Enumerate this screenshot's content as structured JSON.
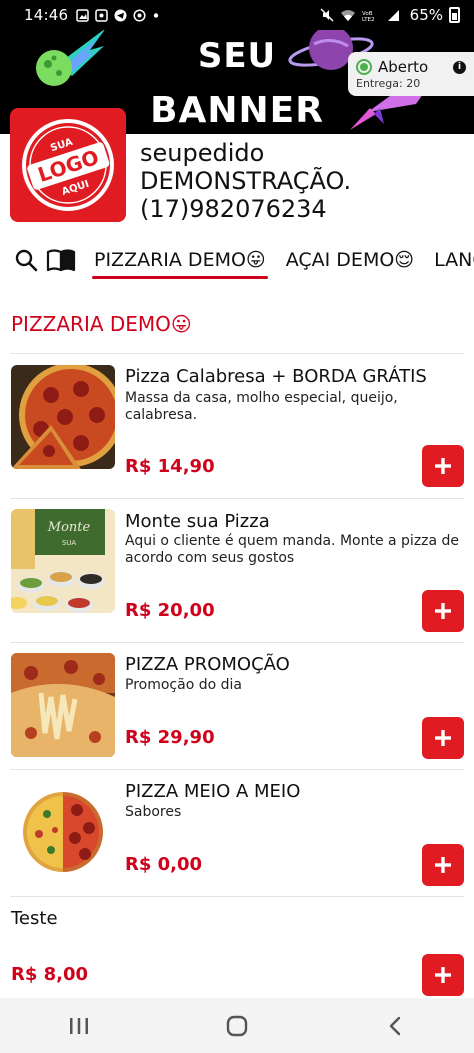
{
  "status_bar": {
    "time": "14:46",
    "battery": "65%",
    "icons_left": [
      "image-icon",
      "notification-icon",
      "telegram-icon",
      "whatsapp-icon",
      "dot-icon"
    ],
    "icons_right": [
      "mute-icon",
      "wifi-icon",
      "volte-icon",
      "signal-icon",
      "battery-icon"
    ]
  },
  "banner": {
    "line1": "SEU",
    "line2": "BANNER"
  },
  "store_status": {
    "label": "Aberto",
    "delivery": "Entrega: 20",
    "status_color": "#4caf50"
  },
  "logo": {
    "top": "SUA",
    "middle": "LOGO",
    "bottom": "AQUI",
    "color": "#e11b22"
  },
  "store": {
    "name": "seupedido",
    "subtitle": "DEMONSTRAÇÃO.",
    "phone": "(17)982076234"
  },
  "tabs": [
    {
      "label": "PIZZARIA DEMO😛",
      "active": true
    },
    {
      "label": "AÇAI DEMO😌",
      "active": false
    },
    {
      "label": "LANCHES",
      "active": false
    }
  ],
  "section": {
    "title": "PIZZARIA DEMO😛"
  },
  "products": [
    {
      "name": "Pizza Calabresa + BORDA GRÁTIS",
      "description": "Massa da casa, molho especial, queijo, calabresa.",
      "price": "R$ 14,90"
    },
    {
      "name": "Monte sua Pizza",
      "description": "Aqui o cliente é quem manda. Monte a pizza de acordo com seus gostos",
      "price": "R$ 20,00"
    },
    {
      "name": "PIZZA PROMOÇÃO",
      "description": "Promoção do dia",
      "price": "R$ 29,90"
    },
    {
      "name": "PIZZA MEIO A MEIO",
      "description": "Sabores",
      "price": "R$ 0,00"
    },
    {
      "name": "Teste",
      "description": "",
      "price": "R$ 8,00"
    }
  ],
  "colors": {
    "accent": "#d0021b",
    "button": "#e11b22"
  }
}
